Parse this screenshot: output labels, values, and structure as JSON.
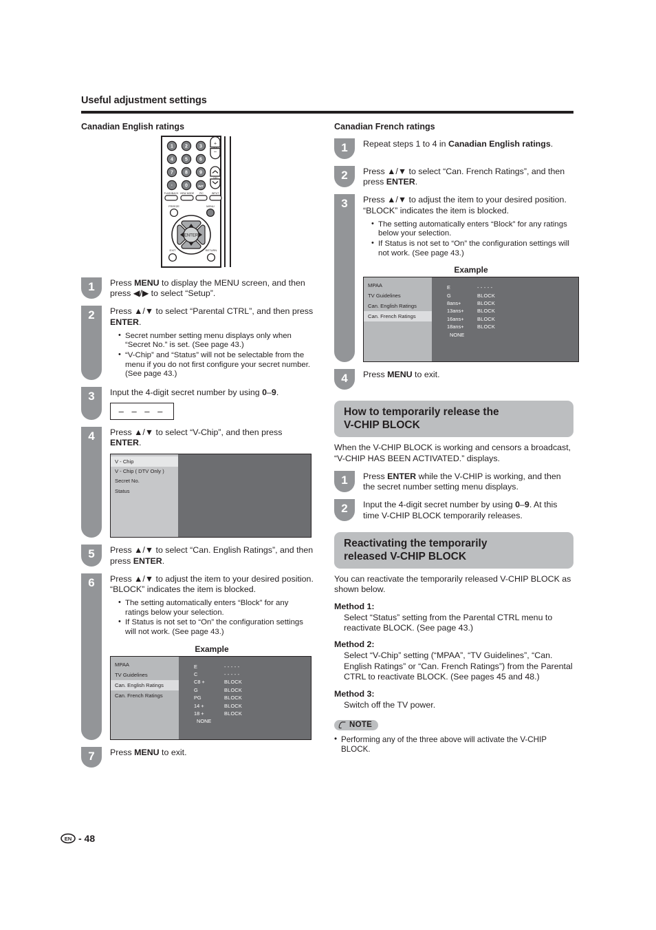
{
  "header": {
    "title": "Useful adjustment settings"
  },
  "left": {
    "heading": "Canadian English ratings",
    "remote": {
      "keys": [
        "1",
        "2",
        "3",
        "4",
        "5",
        "6",
        "7",
        "8",
        "9",
        "·",
        "0",
        "INT"
      ],
      "vol_label": "VOL",
      "ch_label": "CH",
      "fn_buttons": [
        "FLASHBACK",
        "VIEW MODE",
        "PIC",
        "INPUT"
      ],
      "freeze_label": "FREEZE",
      "menu_label": "MENU",
      "enter_label": "ENTER",
      "exit_label": "EXIT",
      "return_label": "RETURN"
    },
    "steps": [
      {
        "num": "1",
        "text_html": "Press <b>MENU</b> to display the MENU screen, and then press ◀/▶ to select “Setup”.",
        "bullets": []
      },
      {
        "num": "2",
        "text_html": "Press ▲/▼ to select “Parental CTRL”, and then press <b>ENTER</b>.",
        "bullets": [
          "Secret number setting menu displays only when “Secret No.” is set. (See page 43.)",
          "“V-Chip” and “Status” will not be selectable from the menu if you do not first configure your secret number. (See page 43.)"
        ]
      },
      {
        "num": "3",
        "text_html": "Input the 4-digit secret number by using <b>0</b>–<b>9</b>.",
        "bullets": []
      },
      {
        "num": "4",
        "text_html": "Press ▲/▼ to select “V-Chip”, and then press <b>ENTER</b>.",
        "bullets": []
      },
      {
        "num": "5",
        "text_html": "Press ▲/▼ to select “Can. English Ratings”, and then press <b>ENTER</b>.",
        "bullets": []
      },
      {
        "num": "6",
        "text_html": "Press ▲/▼ to adjust the item to your desired position. “BLOCK” indicates the item is blocked.",
        "bullets": [
          "The setting automatically enters “Block” for any ratings below your selection.",
          "If Status is not set to “On” the configuration settings will not work. (See page 43.)"
        ]
      },
      {
        "num": "7",
        "text_html": "Press <b>MENU</b> to exit.",
        "bullets": []
      }
    ],
    "secret_box": "– – – –",
    "vchip_menu": {
      "items": [
        "V - Chip",
        "V - Chip ( DTV  Only )",
        "Secret No.",
        "Status"
      ],
      "selected_index": 0
    },
    "example_label": "Example",
    "example": {
      "sidebar": [
        "MPAA",
        "TV Guidelines",
        "Can. English Ratings",
        "Can. French Ratings"
      ],
      "selected_index": 2,
      "rows": [
        {
          "name": "E",
          "value": "- - - - -"
        },
        {
          "name": "C",
          "value": "- - - - -"
        },
        {
          "name": "C8 +",
          "value": "BLOCK"
        },
        {
          "name": "G",
          "value": "BLOCK"
        },
        {
          "name": "PG",
          "value": "BLOCK"
        },
        {
          "name": "14 +",
          "value": "BLOCK"
        },
        {
          "name": "18 +",
          "value": "BLOCK"
        },
        {
          "name": "NONE",
          "value": ""
        }
      ]
    }
  },
  "right": {
    "heading": "Canadian French ratings",
    "steps": [
      {
        "num": "1",
        "text_html": "Repeat steps 1 to 4 in <b>Canadian English ratings</b>.",
        "bullets": []
      },
      {
        "num": "2",
        "text_html": "Press ▲/▼ to select “Can. French Ratings”, and then press <b>ENTER</b>.",
        "bullets": []
      },
      {
        "num": "3",
        "text_html": "Press ▲/▼ to adjust the item to your desired position. “BLOCK” indicates the item is blocked.",
        "bullets": [
          "The setting automatically enters “Block” for any ratings below your selection.",
          "If Status is not set to “On” the configuration settings will not work. (See page 43.)"
        ]
      },
      {
        "num": "4",
        "text_html": "Press <b>MENU</b> to exit.",
        "bullets": []
      }
    ],
    "example_label": "Example",
    "example": {
      "sidebar": [
        "MPAA",
        "TV Guidelines",
        "Can. English Ratings",
        "Can. French Ratings"
      ],
      "selected_index": 3,
      "rows": [
        {
          "name": "E",
          "value": "- - - - -"
        },
        {
          "name": "G",
          "value": "BLOCK"
        },
        {
          "name": "8ans+",
          "value": "BLOCK"
        },
        {
          "name": "13ans+",
          "value": "BLOCK"
        },
        {
          "name": "16ans+",
          "value": "BLOCK"
        },
        {
          "name": "18ans+",
          "value": "BLOCK"
        },
        {
          "name": "NONE",
          "value": ""
        }
      ]
    },
    "release_section": {
      "title_line1": "How to temporarily release the",
      "title_line2": "V-CHIP BLOCK",
      "intro": "When the V-CHIP BLOCK is working and censors a broadcast, “V-CHIP HAS BEEN ACTIVATED.” displays.",
      "steps": [
        {
          "num": "1",
          "text_html": "Press <b>ENTER</b> while the V-CHIP is working, and then the secret number setting menu displays.",
          "bullets": []
        },
        {
          "num": "2",
          "text_html": "Input the 4-digit secret number by using <b>0</b>–<b>9</b>. At this time V-CHIP BLOCK temporarily releases.",
          "bullets": []
        }
      ]
    },
    "reactivate_section": {
      "title_line1": "Reactivating the temporarily",
      "title_line2": "released V-CHIP BLOCK",
      "intro": "You can reactivate the temporarily released V-CHIP BLOCK as shown below.",
      "methods": [
        {
          "head": "Method 1:",
          "body": "Select “Status” setting from the Parental CTRL menu to reactivate BLOCK. (See page 43.)"
        },
        {
          "head": "Method 2:",
          "body": "Select “V-Chip” setting (“MPAA”, “TV Guidelines”, “Can. English Ratings” or “Can. French Ratings”) from the Parental CTRL to reactivate BLOCK. (See pages 45 and 48.)"
        },
        {
          "head": "Method 3:",
          "body": "Switch off the TV power."
        }
      ]
    },
    "note": {
      "label": "NOTE",
      "items": [
        "Performing any of the three above will activate the V-CHIP BLOCK."
      ]
    }
  },
  "footer": {
    "lang_badge": "EN",
    "page": "- 48"
  }
}
